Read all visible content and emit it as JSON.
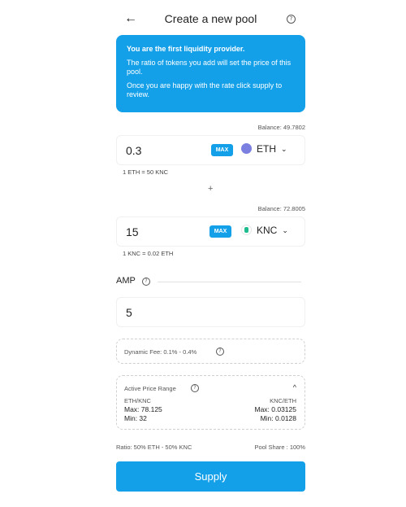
{
  "header": {
    "back_icon": "←",
    "title": "Create a new pool",
    "help_icon": "?"
  },
  "info_box": {
    "line1": "You are the first liquidity provider.",
    "line2": "The ratio of tokens you add will set the price of this pool.",
    "line3": "Once you are happy with the rate click supply to review."
  },
  "token_a": {
    "balance": "Balance: 49.7802",
    "amount": "0.3",
    "max_label": "MAX",
    "symbol": "ETH",
    "rate": "1 ETH = 50 KNC"
  },
  "plus": "+",
  "token_b": {
    "balance": "Balance: 72.8005",
    "amount": "15",
    "max_label": "MAX",
    "symbol": "KNC",
    "rate": "1 KNC = 0.02 ETH"
  },
  "amp": {
    "label": "AMP",
    "value": "5",
    "help_icon": "?"
  },
  "dynamic_fee": {
    "label": "Dynamic Fee: 0.1% - 0.4%",
    "help_icon": "?"
  },
  "price_range": {
    "title": "Active Price Range",
    "help_icon": "?",
    "toggle_icon": "^",
    "left_pair": "ETH/KNC",
    "left_max": "Max: 78.125",
    "left_min": "Min: 32",
    "right_pair": "KNC/ETH",
    "right_max": "Max: 0.03125",
    "right_min": "Min: 0.0128"
  },
  "footer": {
    "ratio": "Ratio: 50% ETH - 50% KNC",
    "pool_share": "Pool Share : 100%"
  },
  "supply_label": "Supply",
  "colors": {
    "accent": "#14a0e8",
    "eth_icon": "#7b7fe0",
    "knc_icon": "#1fbc8f"
  },
  "icons": {
    "eth": "eth-token-icon",
    "knc": "knc-token-icon",
    "chevron": "chevron-down-icon"
  }
}
